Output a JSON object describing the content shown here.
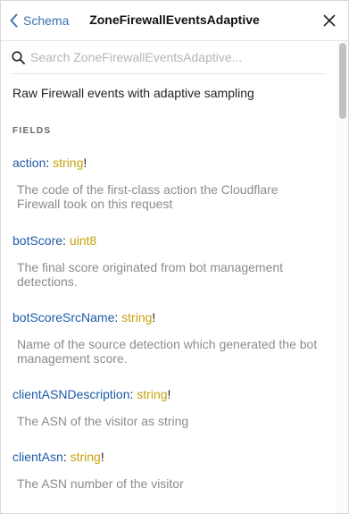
{
  "header": {
    "back_label": "Schema",
    "title": "ZoneFirewallEventsAdaptive"
  },
  "search": {
    "placeholder": "Search ZoneFirewallEventsAdaptive..."
  },
  "type_description": "Raw Firewall events with adaptive sampling",
  "fields_heading": "FIELDS",
  "fields": [
    {
      "name": "action",
      "colon": ":",
      "type": "string",
      "required_mark": "!",
      "description": "The code of the first-class action the Cloudflare Firewall took on this request"
    },
    {
      "name": "botScore",
      "colon": ":",
      "type": "uint8",
      "required_mark": "!",
      "description": "The final score originated from bot management detections."
    },
    {
      "name": "botScoreSrcName",
      "colon": ":",
      "type": "string",
      "required_mark": "!",
      "description": "Name of the source detection which generated the bot management score."
    },
    {
      "name": "clientASNDescription",
      "colon": ":",
      "type": "string",
      "required_mark": "!",
      "description": "The ASN of the visitor as string"
    },
    {
      "name": "clientAsn",
      "colon": ":",
      "type": "string",
      "required_mark": "!",
      "description": "The ASN number of the visitor"
    }
  ],
  "colors": {
    "field_name": "#1e5aa8",
    "field_type": "#c8a10b",
    "back_link": "#3b73af",
    "description_muted": "#8c8c8c"
  },
  "icons": {
    "back": "chevron-left-icon",
    "close": "close-icon",
    "search": "search-icon"
  }
}
